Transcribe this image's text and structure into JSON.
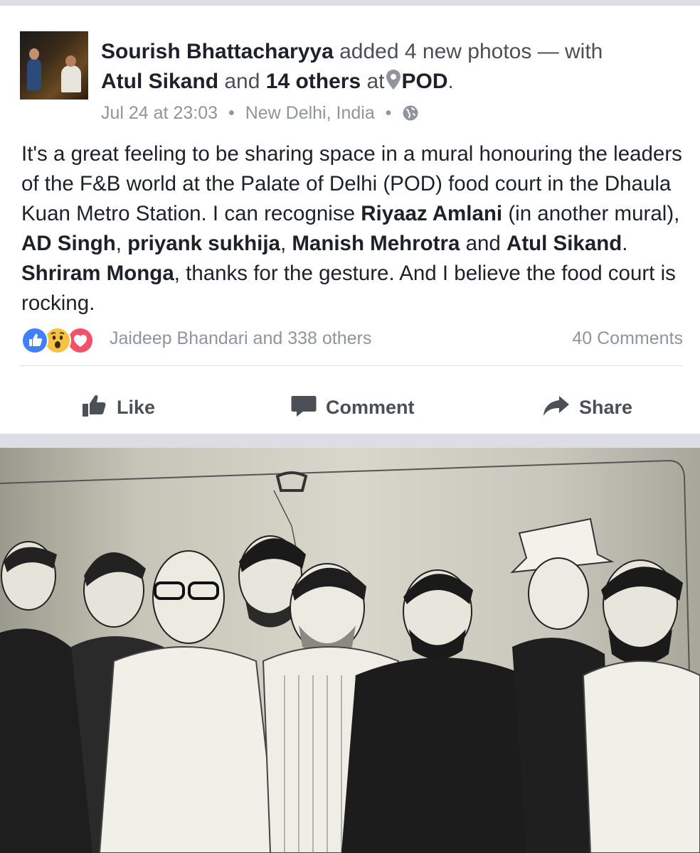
{
  "post": {
    "author": "Sourish Bhattacharyya",
    "action": "added 4 new photos — with",
    "tagged_person": "Atul Sikand",
    "and_word": "and",
    "others_count": "14 others",
    "at_word": "at",
    "place": "POD",
    "period": ".",
    "timestamp": "Jul 24 at 23:03",
    "location": "New Delhi, India",
    "separator": "•",
    "privacy_icon": "globe-icon",
    "location_icon": "map-pin-icon",
    "body": {
      "p1": "It's a great feeling to be sharing space in a mural honouring the leaders of the F&B world at the Palate of Delhi (POD) food court in the Dhaula Kuan Metro Station. I can recognise ",
      "name1": "Riyaaz Amlani",
      "p2": " (in another mural), ",
      "name2": "AD Singh",
      "p3": ", ",
      "name3": "priyank sukhija",
      "p4": ", ",
      "name4": "Manish Mehrotra",
      "p5": " and ",
      "name5": "Atul Sikand",
      "p6": ". ",
      "name6": "Shriram Monga",
      "p7": ", thanks for the gesture. And I believe the food court is rocking."
    }
  },
  "reactions": {
    "icons": [
      "like-reaction-icon",
      "wow-reaction-icon",
      "love-reaction-icon"
    ],
    "summary": "Jaideep Bhandari and 338 others",
    "comments": "40 Comments"
  },
  "actions": {
    "like": "Like",
    "comment": "Comment",
    "share": "Share"
  },
  "colors": {
    "like_blue": "#4080ff",
    "wow_yellow": "#f7c244",
    "love_red": "#f25268",
    "meta_grey": "#90949c",
    "action_grey": "#4b4f56"
  }
}
